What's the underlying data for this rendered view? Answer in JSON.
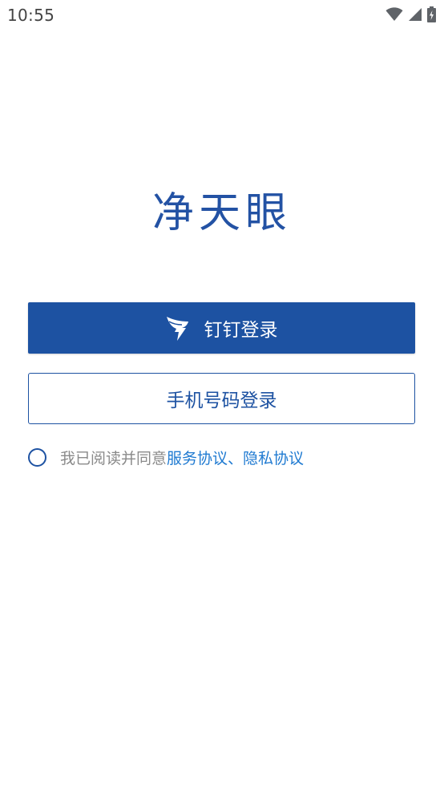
{
  "status_bar": {
    "time": "10:55",
    "icons": [
      "wifi-icon",
      "signal-icon",
      "battery-charging-icon"
    ]
  },
  "app": {
    "logo_text": "净天眼",
    "brand_color": "#1d52a2",
    "link_color": "#1f7ad1"
  },
  "buttons": {
    "dingtalk_label": "钉钉登录",
    "dingtalk_icon": "dingtalk-icon",
    "phone_label": "手机号码登录"
  },
  "agreement": {
    "prefix": "我已阅读并同意",
    "service_link": "服务协议",
    "separator": "、",
    "privacy_link": "隐私协议",
    "checked": false
  }
}
